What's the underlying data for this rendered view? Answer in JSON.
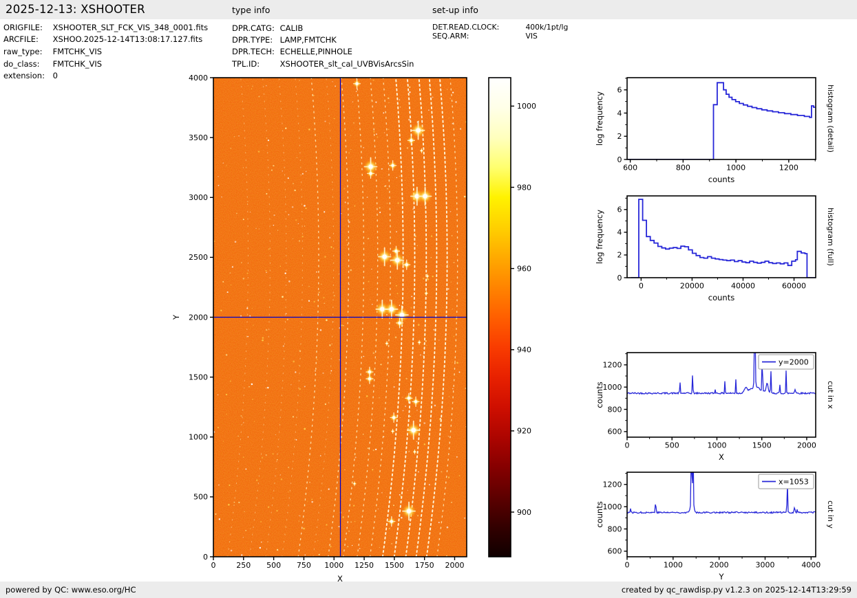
{
  "header": {
    "title": "2025-12-13: XSHOOTER",
    "type_info_label": "type info",
    "setup_info_label": "set-up info"
  },
  "file_info": {
    "rows": [
      {
        "label": "ORIGFILE:",
        "value": "XSHOOTER_SLT_FCK_VIS_348_0001.fits"
      },
      {
        "label": "ARCFILE:",
        "value": "XSHOO.2025-12-14T13:08:17.127.fits"
      },
      {
        "label": "raw_type:",
        "value": "FMTCHK_VIS"
      },
      {
        "label": "do_class:",
        "value": "FMTCHK_VIS"
      },
      {
        "label": "extension:",
        "value": "0"
      }
    ]
  },
  "type_info": {
    "rows": [
      {
        "label": "DPR.CATG:",
        "value": "CALIB"
      },
      {
        "label": "DPR.TYPE:",
        "value": "LAMP,FMTCHK"
      },
      {
        "label": "DPR.TECH:",
        "value": "ECHELLE,PINHOLE"
      },
      {
        "label": "TPL.ID:",
        "value": "XSHOOTER_slt_cal_UVBVisArcsSin"
      }
    ]
  },
  "setup_info": {
    "rows": [
      {
        "label": "DET.READ.CLOCK:",
        "value": "400k/1pt/lg"
      },
      {
        "label": "SEQ.ARM:",
        "value": "VIS"
      }
    ]
  },
  "footer": {
    "left": "powered by QC: www.eso.org/HC",
    "right": "created by qc_rawdisp.py v1.2.3 on 2025-12-14T13:29:59"
  },
  "colors": {
    "line_blue": "#2626d8",
    "crosshair_blue": "#0000c8",
    "strip_bg": "#ececec",
    "image_base": "#f25004"
  },
  "chart_data": [
    {
      "id": "main-image",
      "type": "heatmap",
      "xlabel": "X",
      "ylabel": "Y",
      "xlim": [
        0,
        2100
      ],
      "ylim": [
        0,
        4000
      ],
      "xticks": [
        0,
        250,
        500,
        750,
        1000,
        1250,
        1500,
        1750,
        2000
      ],
      "yticks": [
        0,
        500,
        1000,
        1500,
        2000,
        2500,
        3000,
        3500,
        4000
      ],
      "crosshair": {
        "x": 1053,
        "y": 2000
      },
      "colormap": "hot",
      "background_counts": 950,
      "arc_traces": {
        "apex_y": 2500,
        "max_shift_bottom": 170,
        "max_shift_top": 61,
        "apex_x": [
          288,
          470,
          604,
          739,
          873,
          997,
          1122,
          1247,
          1362,
          1468,
          1573,
          1669,
          1765,
          1851,
          1938,
          2024
        ],
        "brightness": [
          0,
          0,
          0,
          0,
          1,
          0,
          1,
          1,
          1,
          1,
          2,
          2,
          2,
          2,
          2,
          1
        ]
      },
      "bright_spots": [
        [
          1190,
          3950,
          2
        ],
        [
          1698,
          3560,
          3
        ],
        [
          1640,
          3476,
          2
        ],
        [
          1726,
          3390,
          1
        ],
        [
          1304,
          3257,
          3
        ],
        [
          1487,
          3267,
          2
        ],
        [
          1304,
          3200,
          2
        ],
        [
          1688,
          3010,
          3
        ],
        [
          1755,
          3010,
          3
        ],
        [
          1515,
          2552,
          2
        ],
        [
          1419,
          2505,
          3
        ],
        [
          1525,
          2476,
          3
        ],
        [
          1602,
          2438,
          2
        ],
        [
          1774,
          2343,
          1
        ],
        [
          1765,
          2200,
          1
        ],
        [
          1400,
          2067,
          3
        ],
        [
          1477,
          2067,
          3
        ],
        [
          1563,
          2019,
          3
        ],
        [
          1544,
          1952,
          2
        ],
        [
          1438,
          1781,
          1
        ],
        [
          1707,
          1790,
          1
        ],
        [
          1295,
          1543,
          2
        ],
        [
          1295,
          1486,
          2
        ],
        [
          1620,
          1324,
          2
        ],
        [
          1678,
          1295,
          2
        ],
        [
          1496,
          1162,
          2
        ],
        [
          1659,
          1057,
          3
        ],
        [
          1487,
          1048,
          1
        ],
        [
          1669,
          876,
          1
        ],
        [
          1170,
          610,
          1
        ],
        [
          1621,
          381,
          3
        ],
        [
          1477,
          295,
          2
        ]
      ]
    },
    {
      "id": "colorbar",
      "type": "colorbar",
      "ticks": [
        1000,
        980,
        960,
        940,
        920,
        900
      ],
      "vmin": 889,
      "vmax": 1007,
      "gradient": [
        "#ffffff",
        "#ffffe8",
        "#ffffbe",
        "#ffff6e",
        "#fff200",
        "#ffd000",
        "#ffaa00",
        "#ff8400",
        "#ff5f00",
        "#f93c00",
        "#e82100",
        "#cf0f00",
        "#ad0500",
        "#860000",
        "#5e0000",
        "#330000",
        "#100000"
      ]
    },
    {
      "id": "hist-detail",
      "type": "step",
      "xlabel": "counts",
      "ylabel": "log frequency",
      "right_label": "histogram (detail)",
      "xlim": [
        588,
        1302
      ],
      "ylim": [
        0,
        7.05
      ],
      "xticks": [
        600,
        800,
        1000,
        1200
      ],
      "yticks": [
        0,
        2,
        4,
        6
      ],
      "xminor": [
        700,
        900,
        1100,
        1300
      ],
      "yminor": [
        1,
        3,
        5,
        7
      ],
      "points": [
        [
          590,
          0
        ],
        [
          915,
          0
        ],
        [
          915,
          4.72
        ],
        [
          929,
          4.72
        ],
        [
          929,
          6.62
        ],
        [
          953,
          6.62
        ],
        [
          953,
          6.0
        ],
        [
          963,
          6.0
        ],
        [
          963,
          5.62
        ],
        [
          974,
          5.62
        ],
        [
          974,
          5.36
        ],
        [
          985,
          5.36
        ],
        [
          985,
          5.16
        ],
        [
          999,
          5.16
        ],
        [
          999,
          4.98
        ],
        [
          1013,
          4.98
        ],
        [
          1013,
          4.83
        ],
        [
          1028,
          4.83
        ],
        [
          1028,
          4.7
        ],
        [
          1044,
          4.7
        ],
        [
          1044,
          4.58
        ],
        [
          1061,
          4.58
        ],
        [
          1061,
          4.47
        ],
        [
          1079,
          4.47
        ],
        [
          1079,
          4.37
        ],
        [
          1098,
          4.37
        ],
        [
          1098,
          4.28
        ],
        [
          1118,
          4.28
        ],
        [
          1118,
          4.19
        ],
        [
          1139,
          4.19
        ],
        [
          1139,
          4.11
        ],
        [
          1161,
          4.11
        ],
        [
          1161,
          4.03
        ],
        [
          1184,
          4.03
        ],
        [
          1184,
          3.95
        ],
        [
          1208,
          3.95
        ],
        [
          1208,
          3.87
        ],
        [
          1233,
          3.87
        ],
        [
          1233,
          3.79
        ],
        [
          1259,
          3.79
        ],
        [
          1259,
          3.71
        ],
        [
          1279,
          3.71
        ],
        [
          1279,
          3.62
        ],
        [
          1286,
          3.62
        ],
        [
          1286,
          4.62
        ],
        [
          1294,
          4.62
        ],
        [
          1294,
          4.5
        ],
        [
          1300,
          4.5
        ]
      ]
    },
    {
      "id": "hist-full",
      "type": "step",
      "xlabel": "counts",
      "ylabel": "log frequency",
      "right_label": "histogram (full)",
      "xlim": [
        -5500,
        68500
      ],
      "ylim": [
        0,
        7.2
      ],
      "xticks": [
        0,
        20000,
        40000,
        60000
      ],
      "yticks": [
        0,
        2,
        4,
        6
      ],
      "xminor": [
        10000,
        30000,
        50000
      ],
      "yminor": [
        1,
        3,
        5,
        7
      ],
      "points": [
        [
          -4000,
          0
        ],
        [
          -900,
          0
        ],
        [
          -900,
          6.9
        ],
        [
          600,
          6.9
        ],
        [
          600,
          5.05
        ],
        [
          2100,
          5.05
        ],
        [
          2100,
          3.62
        ],
        [
          3600,
          3.62
        ],
        [
          3600,
          3.28
        ],
        [
          5100,
          3.28
        ],
        [
          5100,
          3.05
        ],
        [
          6600,
          3.05
        ],
        [
          6600,
          2.75
        ],
        [
          8100,
          2.75
        ],
        [
          8100,
          2.62
        ],
        [
          9600,
          2.62
        ],
        [
          9600,
          2.52
        ],
        [
          11100,
          2.52
        ],
        [
          11100,
          2.6
        ],
        [
          12600,
          2.6
        ],
        [
          12600,
          2.65
        ],
        [
          14100,
          2.65
        ],
        [
          14100,
          2.58
        ],
        [
          15600,
          2.58
        ],
        [
          15600,
          2.77
        ],
        [
          17100,
          2.77
        ],
        [
          17100,
          2.72
        ],
        [
          18600,
          2.72
        ],
        [
          18600,
          2.45
        ],
        [
          20100,
          2.45
        ],
        [
          20100,
          2.15
        ],
        [
          21600,
          2.15
        ],
        [
          21600,
          1.95
        ],
        [
          23100,
          1.95
        ],
        [
          23100,
          1.78
        ],
        [
          24600,
          1.78
        ],
        [
          24600,
          1.72
        ],
        [
          26100,
          1.72
        ],
        [
          26100,
          1.85
        ],
        [
          27600,
          1.85
        ],
        [
          27600,
          1.72
        ],
        [
          29100,
          1.72
        ],
        [
          29100,
          1.65
        ],
        [
          30600,
          1.65
        ],
        [
          30600,
          1.6
        ],
        [
          32100,
          1.6
        ],
        [
          32100,
          1.55
        ],
        [
          33600,
          1.55
        ],
        [
          33600,
          1.5
        ],
        [
          35100,
          1.5
        ],
        [
          35100,
          1.55
        ],
        [
          36600,
          1.55
        ],
        [
          36600,
          1.42
        ],
        [
          38100,
          1.42
        ],
        [
          38100,
          1.5
        ],
        [
          39600,
          1.5
        ],
        [
          39600,
          1.38
        ],
        [
          41100,
          1.38
        ],
        [
          41100,
          1.32
        ],
        [
          42600,
          1.32
        ],
        [
          42600,
          1.45
        ],
        [
          44100,
          1.45
        ],
        [
          44100,
          1.35
        ],
        [
          45600,
          1.35
        ],
        [
          45600,
          1.28
        ],
        [
          47100,
          1.28
        ],
        [
          47100,
          1.35
        ],
        [
          48600,
          1.35
        ],
        [
          48600,
          1.45
        ],
        [
          50100,
          1.45
        ],
        [
          50100,
          1.32
        ],
        [
          51600,
          1.32
        ],
        [
          51600,
          1.25
        ],
        [
          53100,
          1.25
        ],
        [
          53100,
          1.3
        ],
        [
          54600,
          1.3
        ],
        [
          54600,
          1.22
        ],
        [
          56100,
          1.22
        ],
        [
          56100,
          1.3
        ],
        [
          57600,
          1.3
        ],
        [
          57600,
          1.08
        ],
        [
          59100,
          1.08
        ],
        [
          59100,
          1.45
        ],
        [
          60600,
          1.45
        ],
        [
          60600,
          1.58
        ],
        [
          61300,
          1.58
        ],
        [
          61300,
          2.32
        ],
        [
          62800,
          2.32
        ],
        [
          62800,
          2.18
        ],
        [
          64300,
          2.18
        ],
        [
          64300,
          2.12
        ],
        [
          65100,
          2.12
        ],
        [
          65100,
          0
        ],
        [
          68400,
          0
        ]
      ]
    },
    {
      "id": "cut-x",
      "type": "noise-line",
      "xlabel": "X",
      "ylabel": "counts",
      "right_label": "cut in x",
      "legend": "y=2000",
      "xlim": [
        0,
        2100
      ],
      "ylim": [
        550,
        1310
      ],
      "xticks": [
        0,
        500,
        1000,
        1500,
        2000
      ],
      "yticks": [
        600,
        800,
        1000,
        1200
      ],
      "xminor": [
        250,
        750,
        1250,
        1750
      ],
      "yminor": [
        700,
        900,
        1100,
        1300
      ],
      "baseline": 945,
      "noise_amp": 7,
      "seed": 42,
      "spikes": [
        [
          588,
          1065,
          4
        ],
        [
          730,
          1148,
          4
        ],
        [
          983,
          993,
          4
        ],
        [
          1090,
          1072,
          4
        ],
        [
          1210,
          1080,
          4
        ],
        [
          1320,
          985,
          25
        ],
        [
          1422,
          1600,
          7
        ],
        [
          1430,
          1000,
          80
        ],
        [
          1505,
          1270,
          5
        ],
        [
          1560,
          1030,
          15
        ],
        [
          1600,
          1190,
          4
        ],
        [
          1700,
          1032,
          4
        ],
        [
          1770,
          1148,
          4
        ],
        [
          1870,
          978,
          10
        ]
      ]
    },
    {
      "id": "cut-y",
      "type": "noise-line",
      "xlabel": "Y",
      "ylabel": "counts",
      "right_label": "cut in y",
      "legend": "x=1053",
      "xlim": [
        0,
        4100
      ],
      "ylim": [
        550,
        1310
      ],
      "xticks": [
        0,
        1000,
        2000,
        3000,
        4000
      ],
      "yticks": [
        600,
        800,
        1000,
        1200
      ],
      "xminor": [
        500,
        1500,
        2500,
        3500
      ],
      "yminor": [
        700,
        900,
        1100,
        1300
      ],
      "baseline": 948,
      "noise_amp": 7,
      "seed": 77,
      "spikes": [
        [
          70,
          992,
          8
        ],
        [
          620,
          1078,
          9
        ],
        [
          1398,
          1550,
          9
        ],
        [
          1432,
          1550,
          9
        ],
        [
          1415,
          1060,
          45
        ],
        [
          3482,
          1300,
          8
        ],
        [
          3640,
          990,
          14
        ],
        [
          3700,
          978,
          9
        ]
      ]
    }
  ]
}
